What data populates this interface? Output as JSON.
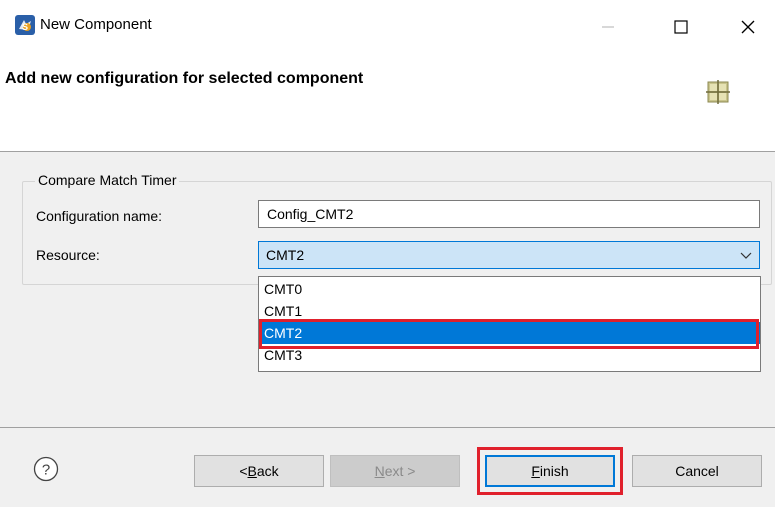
{
  "window": {
    "title": "New Component",
    "controls": {
      "minimize": "—",
      "maximize": "☐",
      "close": "✕"
    }
  },
  "header": {
    "title": "Add new configuration for selected component",
    "icon": "component-grid-icon"
  },
  "group": {
    "legend": "Compare Match Timer",
    "config_name_label": "Configuration name:",
    "config_name_value": "Config_CMT2",
    "resource_label": "Resource:",
    "resource_value": "CMT2"
  },
  "dropdown": {
    "options": [
      "CMT0",
      "CMT1",
      "CMT2",
      "CMT3"
    ],
    "selected_index": 2
  },
  "footer": {
    "help_icon": "help-icon",
    "back": {
      "prefix": "< ",
      "mnemonic": "B",
      "rest": "ack"
    },
    "next": {
      "mnemonic": "N",
      "rest": "ext >"
    },
    "finish": {
      "mnemonic": "F",
      "rest": "inish"
    },
    "cancel": "Cancel"
  },
  "colors": {
    "accent": "#0078d7",
    "highlight_red": "#e0202c",
    "panel_bg": "#f0f0f0"
  }
}
